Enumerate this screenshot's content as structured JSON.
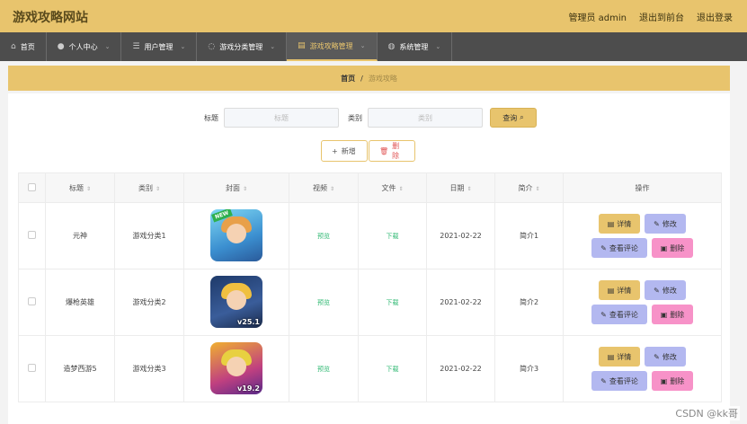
{
  "header": {
    "site_title": "游戏攻略网站",
    "admin_label": "管理员 admin",
    "back_to_front": "退出到前台",
    "logout": "退出登录"
  },
  "nav": {
    "items": [
      {
        "label": "首页",
        "icon": "home-icon",
        "chevron": false,
        "active": false
      },
      {
        "label": "个人中心",
        "icon": "user-icon",
        "chevron": true,
        "active": false
      },
      {
        "label": "用户管理",
        "icon": "sliders-icon",
        "chevron": true,
        "active": false
      },
      {
        "label": "游戏分类管理",
        "icon": "lightbulb-icon",
        "chevron": true,
        "active": false
      },
      {
        "label": "游戏攻略管理",
        "icon": "bank-icon",
        "chevron": true,
        "active": true
      },
      {
        "label": "系统管理",
        "icon": "globe-icon",
        "chevron": true,
        "active": false
      }
    ]
  },
  "breadcrumb": {
    "home": "首页",
    "separator": "/",
    "current": "游戏攻略"
  },
  "search": {
    "title_label": "标题",
    "title_placeholder": "标题",
    "category_label": "类别",
    "category_placeholder": "类别",
    "query_button": "查询"
  },
  "actions": {
    "add": "新增",
    "delete": "删除"
  },
  "table": {
    "headers": {
      "title": "标题",
      "category": "类别",
      "cover": "封面",
      "video": "视频",
      "file": "文件",
      "date": "日期",
      "intro": "简介",
      "ops": "操作"
    },
    "rows": [
      {
        "title": "元神",
        "category": "游戏分类1",
        "video": "预览",
        "file": "下载",
        "date": "2021-02-22",
        "intro": "简介1",
        "cover_badge": "NEW",
        "cover_version": ""
      },
      {
        "title": "爆枪英雄",
        "category": "游戏分类2",
        "video": "预览",
        "file": "下载",
        "date": "2021-02-22",
        "intro": "简介2",
        "cover_badge": "",
        "cover_version": "v25.1"
      },
      {
        "title": "造梦西游5",
        "category": "游戏分类3",
        "video": "预览",
        "file": "下载",
        "date": "2021-02-22",
        "intro": "简介3",
        "cover_badge": "",
        "cover_version": "v19.2"
      }
    ],
    "row_buttons": {
      "detail": "详情",
      "edit": "修改",
      "comments": "查看评论",
      "delete": "删除"
    }
  },
  "watermark": "CSDN @kk哥",
  "colors": {
    "accent": "#e8c46d",
    "nav_bg": "#4d4d4d",
    "edit_btn": "#b3b8f0",
    "delete_btn": "#f792c8",
    "link_green": "#2eb872"
  }
}
